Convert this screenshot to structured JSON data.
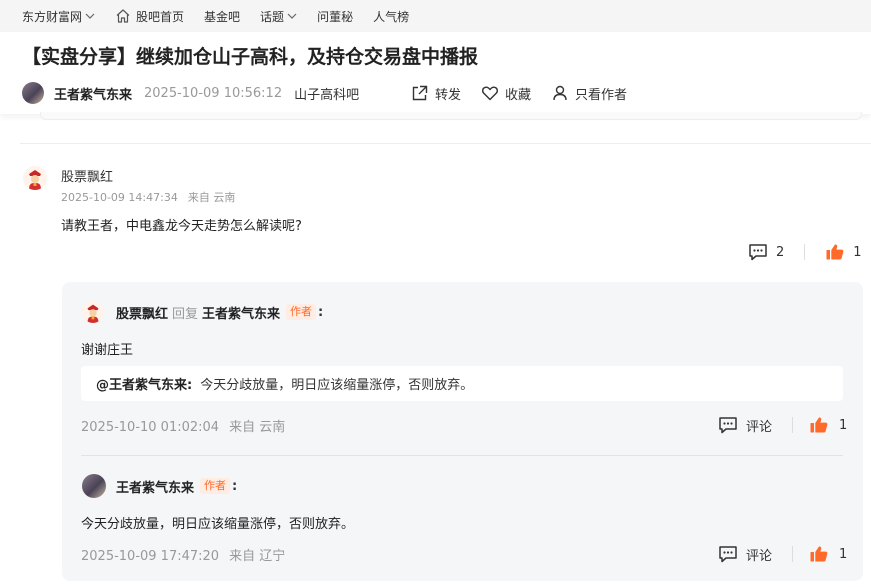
{
  "topnav": {
    "items": [
      {
        "label": "东方财富网",
        "has_dropdown": true
      },
      {
        "label": "股吧首页",
        "icon": "home-icon"
      },
      {
        "label": "基金吧"
      },
      {
        "label": "话题",
        "has_dropdown": true
      },
      {
        "label": "问董秘"
      },
      {
        "label": "人气榜"
      }
    ]
  },
  "post": {
    "title": "【实盘分享】继续加仓山子高科，及持仓交易盘中播报",
    "author": "王者紫气东来",
    "time": "2025-10-09 10:56:12",
    "bar": "山子高科吧",
    "actions": {
      "forward": "转发",
      "favorite": "收藏",
      "author_only": "只看作者"
    }
  },
  "comment": {
    "author": "股票飘红",
    "time": "2025-10-09 14:47:34",
    "location": "来自 云南",
    "text": "请教王者，中电鑫龙今天走势怎么解读呢?",
    "comment_count": "2",
    "like_count": "1"
  },
  "replies": [
    {
      "author": "股票飘红",
      "reply_word": "回复",
      "reply_to": "王者紫气东来",
      "tag": "作者",
      "colon": ":",
      "text": "谢谢庄王",
      "quote_at": "@王者紫气东来:",
      "quote_text": "今天分歧放量，明日应该缩量涨停，否则放弃。",
      "time": "2025-10-10 01:02:04",
      "location": "来自 云南",
      "comment_label": "评论",
      "like_count": "1"
    },
    {
      "author": "王者紫气东来",
      "tag": "作者",
      "colon": ":",
      "text": "今天分歧放量，明日应该缩量涨停，否则放弃。",
      "time": "2025-10-09 17:47:20",
      "location": "来自 辽宁",
      "comment_label": "评论",
      "like_count": "1"
    }
  ],
  "colors": {
    "accent": "#ff6a2a",
    "tag_bg": "#ffece3",
    "reply_bg": "#f5f6f7",
    "muted": "#999999"
  }
}
